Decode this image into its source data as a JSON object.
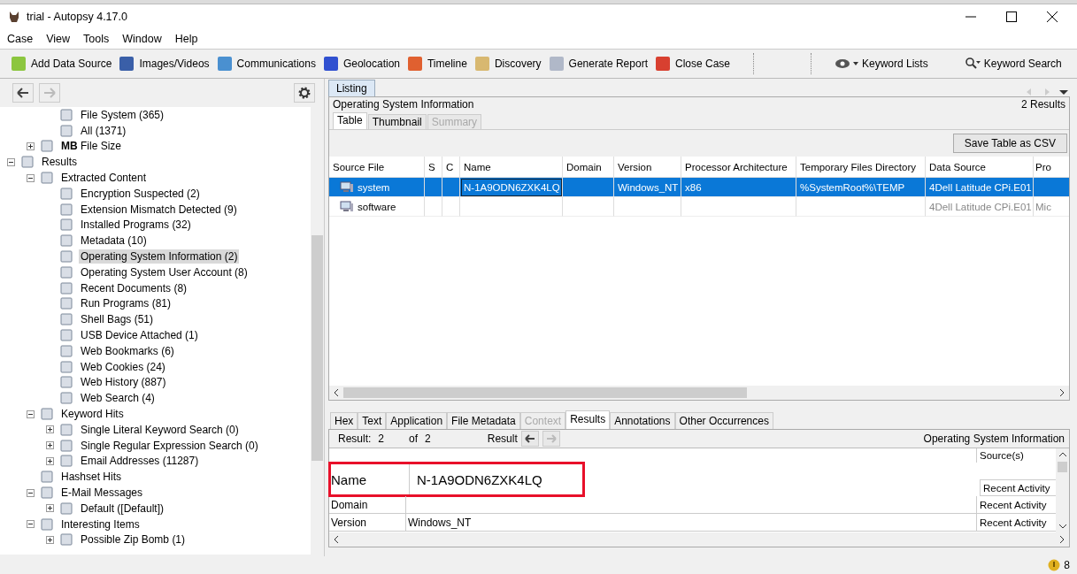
{
  "window": {
    "title": "trial - Autopsy 4.17.0"
  },
  "menu": [
    "Case",
    "View",
    "Tools",
    "Window",
    "Help"
  ],
  "toolbar": [
    {
      "label": "Add Data Source"
    },
    {
      "label": "Images/Videos"
    },
    {
      "label": "Communications"
    },
    {
      "label": "Geolocation"
    },
    {
      "label": "Timeline"
    },
    {
      "label": "Discovery"
    },
    {
      "label": "Generate Report"
    },
    {
      "label": "Close Case"
    }
  ],
  "keyword_lists": "Keyword Lists",
  "keyword_search": "Keyword Search",
  "tree": [
    {
      "children": [
        {
          "children": [
            {
              "label": "File System (365)"
            },
            {
              "label": "All (1371)"
            }
          ]
        },
        {
          "label": "**MB** File Size",
          "expanded": false
        }
      ]
    },
    {
      "label": "Results",
      "expanded": true,
      "children": [
        {
          "label": "Extracted Content",
          "expanded": true,
          "children": [
            {
              "label": "Encryption Suspected (2)",
              "selected": false
            },
            {
              "label": "Extension Mismatch Detected (9)",
              "selected": false
            },
            {
              "label": "Installed Programs (32)",
              "selected": false
            },
            {
              "label": "Metadata (10)",
              "selected": false
            },
            {
              "label": "Operating System Information (2)",
              "selected": true
            },
            {
              "label": "Operating System User Account (8)",
              "selected": false
            },
            {
              "label": "Recent Documents (8)",
              "selected": false
            },
            {
              "label": "Run Programs (81)",
              "selected": false
            },
            {
              "label": "Shell Bags (51)",
              "selected": false
            },
            {
              "label": "USB Device Attached (1)",
              "selected": false
            },
            {
              "label": "Web Bookmarks (6)",
              "selected": false
            },
            {
              "label": "Web Cookies (24)",
              "selected": false
            },
            {
              "label": "Web History (887)",
              "selected": false
            },
            {
              "label": "Web Search (4)",
              "selected": false
            }
          ]
        },
        {
          "label": "Keyword Hits",
          "expanded": true,
          "children": [
            {
              "label": "Single Literal Keyword Search (0)",
              "expanded": false
            },
            {
              "label": "Single Regular Expression Search (0)",
              "expanded": false
            },
            {
              "label": "Email Addresses (11287)",
              "expanded": false
            }
          ]
        },
        {
          "label": "Hashset Hits"
        },
        {
          "label": "E-Mail Messages",
          "expanded": true,
          "children": [
            {
              "label": "Default ([Default])",
              "expanded": false
            }
          ]
        },
        {
          "label": "Interesting Items",
          "expanded": true,
          "children": [
            {
              "label": "Possible Zip Bomb (1)",
              "expanded": false
            }
          ]
        }
      ]
    }
  ],
  "listing": {
    "tab": "Listing",
    "title": "Operating System Information",
    "count": "2  Results",
    "view_tabs": [
      {
        "label": "Table",
        "selected": true,
        "disabled": false
      },
      {
        "label": "Thumbnail",
        "selected": false,
        "disabled": false
      },
      {
        "label": "Summary",
        "selected": false,
        "disabled": true
      }
    ],
    "save_button": "Save Table as CSV",
    "columns": [
      "Source File",
      "S",
      "C",
      "Name",
      "Domain",
      "Version",
      "Processor Architecture",
      "Temporary Files Directory",
      "Data Source",
      "Pro"
    ],
    "rows": [
      {
        "selected": true,
        "cells": [
          "system",
          "",
          "",
          "N-1A9ODN6ZXK4LQ",
          "",
          "Windows_NT",
          "x86",
          "%SystemRoot%\\TEMP",
          "4Dell Latitude CPi.E01",
          ""
        ]
      },
      {
        "selected": false,
        "cells": [
          "software",
          "",
          "",
          "",
          "",
          "",
          "",
          "",
          "4Dell Latitude CPi.E01",
          "Mic"
        ]
      }
    ]
  },
  "content": {
    "tabs": [
      {
        "label": "Hex",
        "selected": false,
        "disabled": false
      },
      {
        "label": "Text",
        "selected": false,
        "disabled": false
      },
      {
        "label": "Application",
        "selected": false,
        "disabled": false
      },
      {
        "label": "File Metadata",
        "selected": false,
        "disabled": false
      },
      {
        "label": "Context",
        "selected": false,
        "disabled": true
      },
      {
        "label": "Results",
        "selected": true,
        "disabled": false
      },
      {
        "label": "Annotations",
        "selected": false,
        "disabled": false
      },
      {
        "label": "Other Occurrences",
        "selected": false,
        "disabled": false
      }
    ],
    "result_label": "Result:",
    "result_index": "2",
    "of_label": "of",
    "result_total": "2",
    "result_nav_label": "Result",
    "artifact_type": "Operating System Information",
    "sources_header": "Source(s)",
    "properties": [
      {
        "name": "Name",
        "value": "N-1A9ODN6ZXK4LQ",
        "source": "Recent Activity",
        "highlighted": true
      },
      {
        "name": "Domain",
        "source": "Recent Activity",
        "highlighted": false
      },
      {
        "name": "Version",
        "value": "Windows_NT",
        "source": "Recent Activity",
        "highlighted": false
      }
    ]
  },
  "status_bar": {
    "notifications": "8"
  }
}
